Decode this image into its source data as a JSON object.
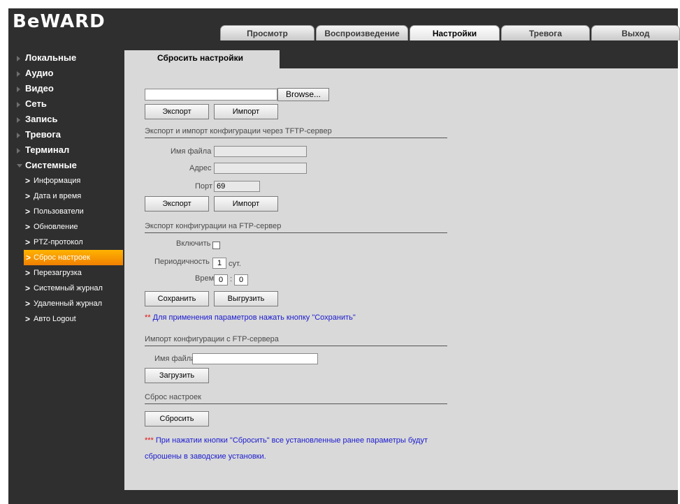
{
  "brand": {
    "logo": "BeWARD"
  },
  "topnav": {
    "tabs": [
      "Просмотр",
      "Воспроизведение",
      "Настройки",
      "Тревога",
      "Выход"
    ],
    "active": "Настройки"
  },
  "sidebar": {
    "top_items": [
      "Локальные",
      "Аудио",
      "Видео",
      "Сеть",
      "Запись",
      "Тревога",
      "Терминал",
      "Системные"
    ],
    "sub_items": [
      "Информация",
      "Дата и время",
      "Пользователи",
      "Обновление",
      "PTZ-протокол",
      "Сброс настроек",
      "Перезагрузка",
      "Системный журнал",
      "Удаленный журнал",
      "Авто Logout"
    ],
    "active_sub": "Сброс настроек"
  },
  "page": {
    "title": "Сбросить настройки",
    "file_browse": {
      "value": "",
      "browse_label": "Browse..."
    },
    "local": {
      "export_label": "Экспорт",
      "import_label": "Импорт"
    },
    "tftp": {
      "heading": "Экспорт и импорт конфигурации через TFTP-сервер",
      "filename_label": "Имя файла",
      "filename_value": "",
      "address_label": "Адрес",
      "address_value": "",
      "port_label": "Порт",
      "port_value": "69",
      "export_label": "Экспорт",
      "import_label": "Импорт"
    },
    "ftp_export": {
      "heading": "Экспорт конфигурации на FTP-сервер",
      "enable_label": "Включить",
      "enabled": false,
      "period_label": "Периодичность",
      "period_value": "1",
      "period_unit": "сут.",
      "time_label": "Время",
      "time_hours": "0",
      "time_sep": ":",
      "time_minutes": "0",
      "save_label": "Сохранить",
      "upload_label": "Выгрузить",
      "note_stars": "**",
      "note_text": " Для применения параметров нажать кнопку \"Сохранить\""
    },
    "ftp_import": {
      "heading": "Импорт конфигурации с FTP-сервера",
      "filename_label": "Имя файла",
      "filename_value": "",
      "load_label": "Загрузить"
    },
    "reset": {
      "heading": "Сброс настроек",
      "reset_label": "Сбросить",
      "note_stars": "***",
      "note_line1": " При нажатии кнопки \"Сбросить\" все установленные ранее параметры будут",
      "note_line2": "сброшены в заводские установки."
    }
  },
  "colors": {
    "frame_bg": "#2f2f2f",
    "content_bg": "#d9d9d9",
    "active_item": "#f59a00",
    "note_text": "#1a1ad0",
    "note_star": "#e01010"
  }
}
